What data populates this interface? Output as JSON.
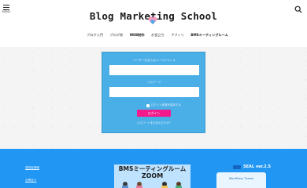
{
  "header": {
    "menu_label": "MENU",
    "logo_text": "Blog Marketing School"
  },
  "nav": {
    "items": [
      {
        "label": "ブログ入門"
      },
      {
        "label": "ブログ術"
      },
      {
        "label": "WEB制作"
      },
      {
        "label": "お役立ち"
      },
      {
        "label": "アフィリ"
      },
      {
        "label": "BMSミーティングルーム"
      }
    ]
  },
  "login": {
    "username_label": "ユーザー名またはメールアドレス",
    "password_label": "パスワード",
    "remember_label": "ログイン状態を保存する",
    "submit_label": "ログイン",
    "forgot_link": "パスワードをお忘れですか？"
  },
  "footer": {
    "links": [
      "運営者情報",
      "お問合せ"
    ],
    "banner_title": "BMSミーティングルーム",
    "banner_subtitle": "ZOOM",
    "seal_title": "SEAL ver.2.5",
    "seal_card_text": "WordPress Theme"
  },
  "colors": {
    "card_bg": "#4aaee7",
    "login_button": "#f41a8b",
    "footer_bg": "#2196f3"
  }
}
